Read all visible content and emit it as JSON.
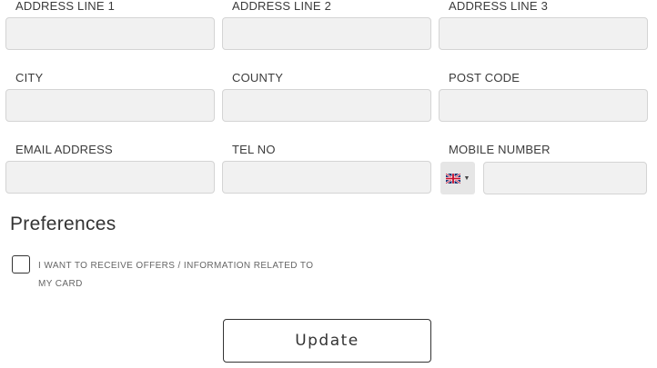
{
  "address": {
    "line1_label": "ADDRESS LINE 1",
    "line2_label": "ADDRESS LINE 2",
    "line3_label": "ADDRESS LINE 3",
    "line1_value": "",
    "line2_value": "",
    "line3_value": ""
  },
  "location": {
    "city_label": "CITY",
    "county_label": "COUNTY",
    "postcode_label": "POST CODE",
    "city_value": "",
    "county_value": "",
    "postcode_value": ""
  },
  "contact": {
    "email_label": "EMAIL ADDRESS",
    "tel_label": "TEL NO",
    "mobile_label": "MOBILE NUMBER",
    "email_value": "",
    "tel_value": "",
    "mobile_value": "",
    "mobile_country_icon": "uk-flag-icon"
  },
  "preferences": {
    "title": "Preferences",
    "offers_label": "I WANT TO RECEIVE OFFERS / INFORMATION RELATED TO MY CARD",
    "offers_checked": false
  },
  "actions": {
    "update_label": "Update"
  },
  "colors": {
    "input_background": "#f1f1f1",
    "input_border": "#d4d4d4",
    "text": "#3b3b3b"
  }
}
